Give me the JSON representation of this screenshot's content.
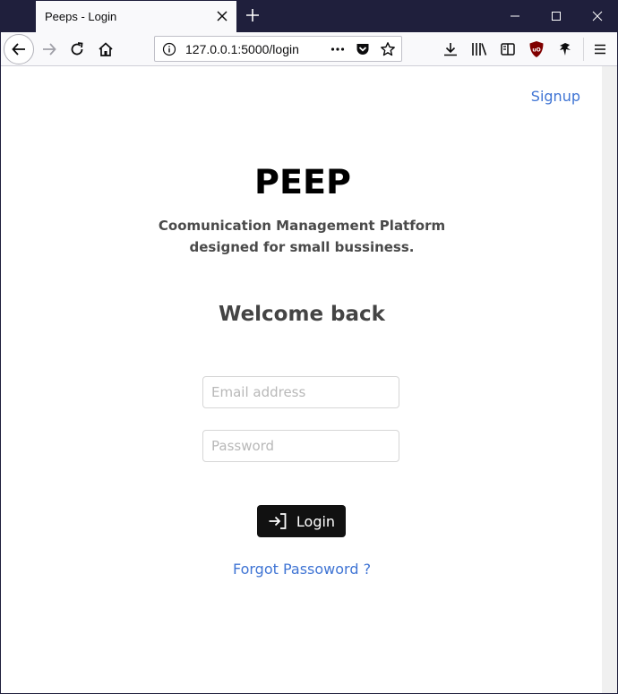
{
  "browser": {
    "tab_title": "Peeps - Login",
    "url": "127.0.0.1:5000/login"
  },
  "page": {
    "signup_label": "Signup",
    "logo_text": "PEEP",
    "tagline": "Coomunication Management Platform designed for small bussiness.",
    "welcome": "Welcome back",
    "email_placeholder": "Email address",
    "password_placeholder": "Password",
    "login_label": "Login",
    "forgot_label": "Forgot Passoword ?"
  },
  "colors": {
    "titlebar": "#1f1f3c",
    "link": "#3f74d4",
    "button": "#111111"
  }
}
